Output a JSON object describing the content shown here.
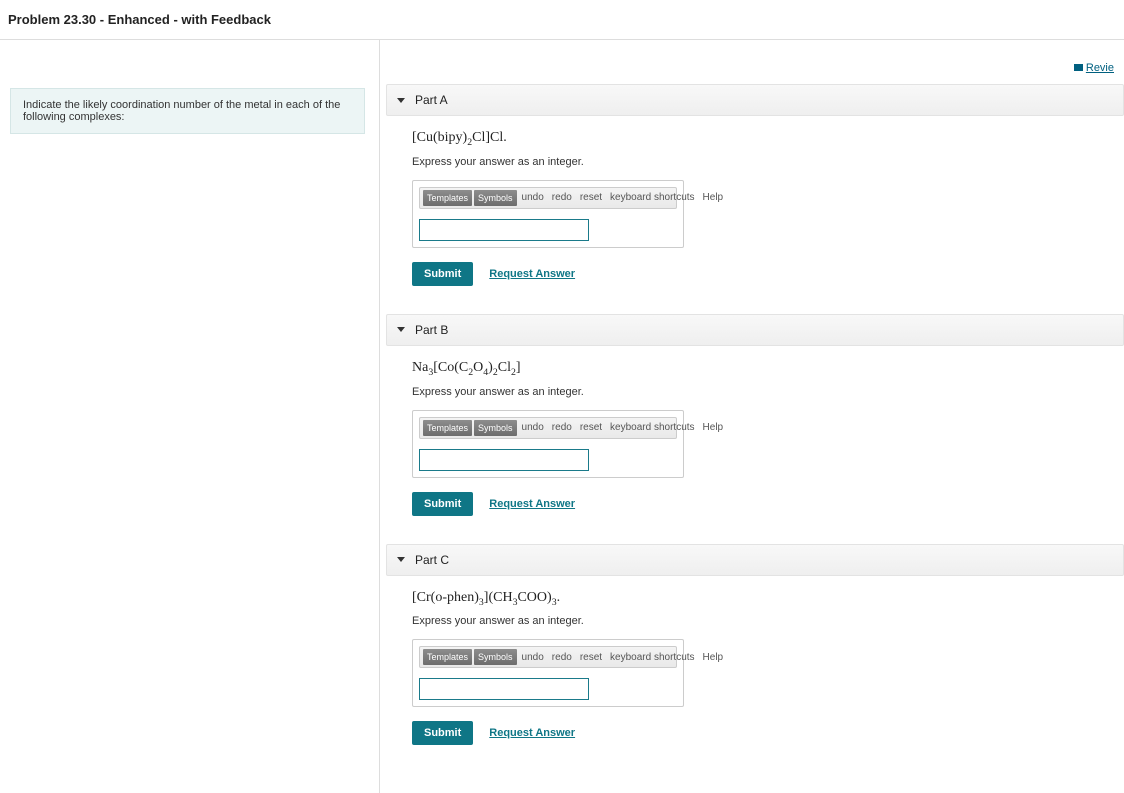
{
  "page_title": "Problem 23.30 - Enhanced - with Feedback",
  "review_link": "Revie",
  "intro_text": "Indicate the likely coordination number of the metal in each of the following complexes:",
  "toolbar": {
    "templates": "Templates",
    "symbols": "Symbols",
    "undo": "undo",
    "redo": "redo",
    "reset": "reset",
    "keyboard": "keyboard shortcuts",
    "help": "Help"
  },
  "submit_label": "Submit",
  "request_label": "Request Answer",
  "parts": [
    {
      "label": "Part A",
      "formula_html": "[Cu(bipy)<sub>2</sub>Cl]Cl.",
      "instruction": "Express your answer as an integer.",
      "value": ""
    },
    {
      "label": "Part B",
      "formula_html": "Na<sub>3</sub>[Co(C<sub>2</sub>O<sub>4</sub>)<sub>2</sub>Cl<sub>2</sub>]",
      "instruction": "Express your answer as an integer.",
      "value": ""
    },
    {
      "label": "Part C",
      "formula_html": "[Cr(o-phen)<sub>3</sub>](CH<sub>3</sub>COO)<sub>3</sub>.",
      "instruction": "Express your answer as an integer.",
      "value": ""
    }
  ]
}
